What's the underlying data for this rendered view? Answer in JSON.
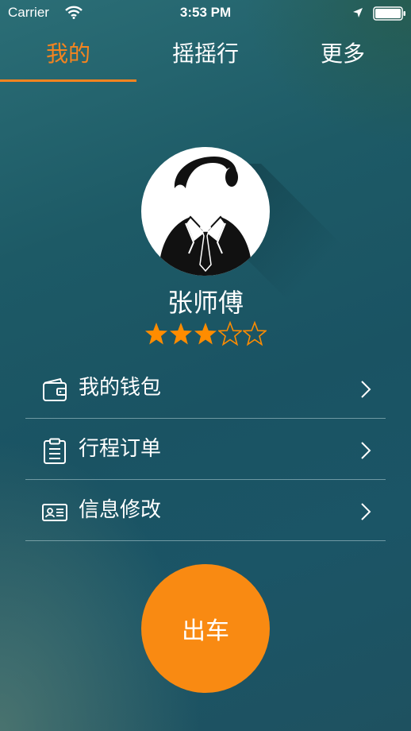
{
  "status_bar": {
    "carrier": "Carrier",
    "time": "3:53 PM",
    "icons": [
      "wifi-icon",
      "location-arrow-icon",
      "battery-icon"
    ]
  },
  "tabs": [
    {
      "label": "我的",
      "active": true
    },
    {
      "label": "摇摇行",
      "active": false
    },
    {
      "label": "更多",
      "active": false
    }
  ],
  "profile": {
    "name": "张师傅",
    "avatar_icon": "driver-avatar-icon",
    "rating": 3,
    "rating_max": 5
  },
  "menu": [
    {
      "label": "我的钱包",
      "icon": "wallet-icon"
    },
    {
      "label": "行程订单",
      "icon": "clipboard-icon"
    },
    {
      "label": "信息修改",
      "icon": "id-card-icon"
    }
  ],
  "depart_button": {
    "label": "出车"
  },
  "colors": {
    "accent": "#f5841f",
    "button": "#f98a12",
    "star": "#ff8c00",
    "background": "#1d5a66"
  }
}
